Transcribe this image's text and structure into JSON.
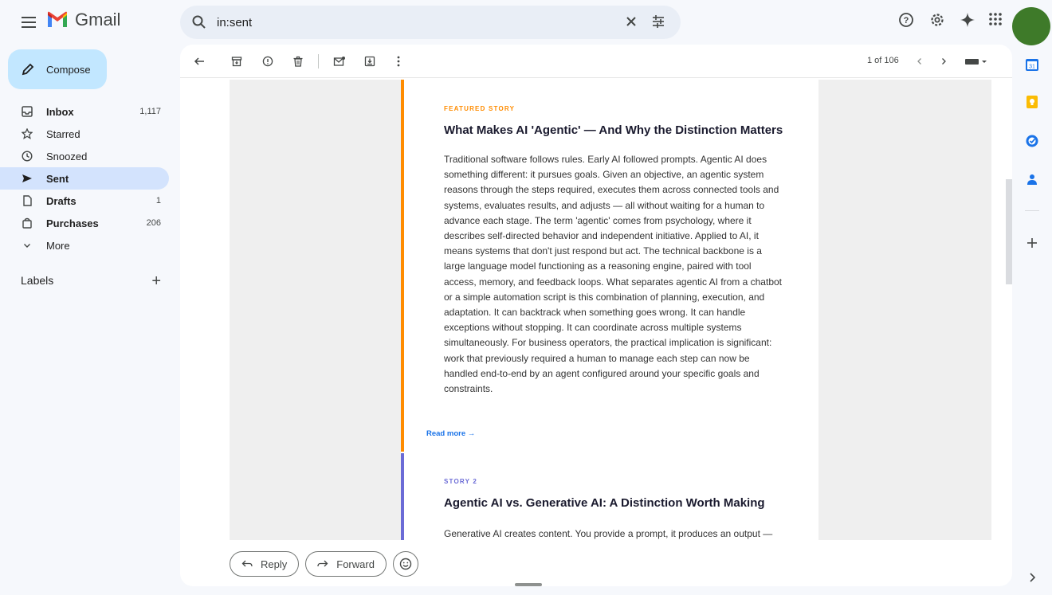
{
  "app": {
    "name": "Gmail"
  },
  "search": {
    "value": "in:sent"
  },
  "compose": {
    "label": "Compose"
  },
  "nav": [
    {
      "name": "inbox",
      "label": "Inbox",
      "count": "1,117",
      "icon": "inbox-icon"
    },
    {
      "name": "starred",
      "label": "Starred",
      "count": "",
      "icon": "star-icon"
    },
    {
      "name": "snoozed",
      "label": "Snoozed",
      "count": "",
      "icon": "clock-icon"
    },
    {
      "name": "sent",
      "label": "Sent",
      "count": "",
      "icon": "send-icon"
    },
    {
      "name": "drafts",
      "label": "Drafts",
      "count": "1",
      "icon": "file-icon"
    },
    {
      "name": "purchases",
      "label": "Purchases",
      "count": "206",
      "icon": "bag-icon"
    },
    {
      "name": "more",
      "label": "More",
      "count": "",
      "icon": "chevron-down-icon"
    }
  ],
  "labels": {
    "title": "Labels"
  },
  "pager": {
    "text": "1 of 106"
  },
  "stories": [
    {
      "kicker": "FEATURED STORY",
      "title": "What Makes AI 'Agentic' — And Why the Distinction Matters",
      "body": "Traditional software follows rules. Early AI followed prompts. Agentic AI does something different: it pursues goals. Given an objective, an agentic system reasons through the steps required, executes them across connected tools and systems, evaluates results, and adjusts — all without waiting for a human to advance each stage. The term 'agentic' comes from psychology, where it describes self-directed behavior and independent initiative. Applied to AI, it means systems that don't just respond but act. The technical backbone is a large language model functioning as a reasoning engine, paired with tool access, memory, and feedback loops. What separates agentic AI from a chatbot or a simple automation script is this combination of planning, execution, and adaptation. It can backtrack when something goes wrong. It can handle exceptions without stopping. It can coordinate across multiple systems simultaneously. For business operators, the practical implication is significant: work that previously required a human to manage each step can now be handled end-to-end by an agent configured around your specific goals and constraints.",
      "read_more": "Read more →",
      "accent": "#ff8c00"
    },
    {
      "kicker": "STORY 2",
      "title": "Agentic AI vs. Generative AI: A Distinction Worth Making",
      "body": "Generative AI creates content. You provide a prompt, it produces an output —",
      "accent": "#6b6bd6"
    }
  ],
  "actions": {
    "reply": "Reply",
    "forward": "Forward"
  },
  "colors": {
    "link": "#1a73e8",
    "active_nav": "#d3e3fd",
    "compose": "#c2e7ff",
    "avatar": "#3e7a29"
  }
}
